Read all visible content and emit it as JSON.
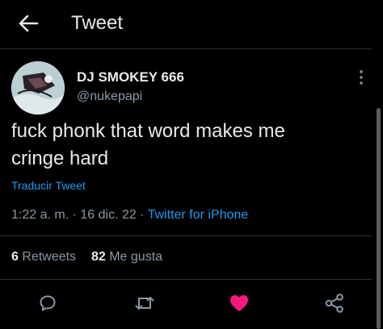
{
  "header": {
    "back_icon": "arrow-left-icon",
    "title": "Tweet"
  },
  "tweet": {
    "author": {
      "display_name": "DJ SMOKEY 666",
      "handle": "@nukepapi"
    },
    "text_line1": "fuck phonk that word makes me",
    "text_line2": "cringe hard",
    "translate_label": "Traducir Tweet",
    "time": "1:22 a. m.",
    "separator": " · ",
    "date": "16 dic. 22",
    "source": "Twitter for iPhone"
  },
  "stats": {
    "retweets_count": "6",
    "retweets_label": "Retweets",
    "likes_count": "82",
    "likes_label": "Me gusta"
  },
  "actions": [
    {
      "icon": "reply-icon"
    },
    {
      "icon": "retweet-icon"
    },
    {
      "icon": "heart-filled-icon",
      "active": true
    },
    {
      "icon": "share-icon"
    }
  ],
  "colors": {
    "background": "#000000",
    "text": "#e7e9ea",
    "secondary_text": "#8b98a5",
    "link": "#1d9bf0",
    "like_active": "#f91880",
    "divider": "#2f3336"
  }
}
